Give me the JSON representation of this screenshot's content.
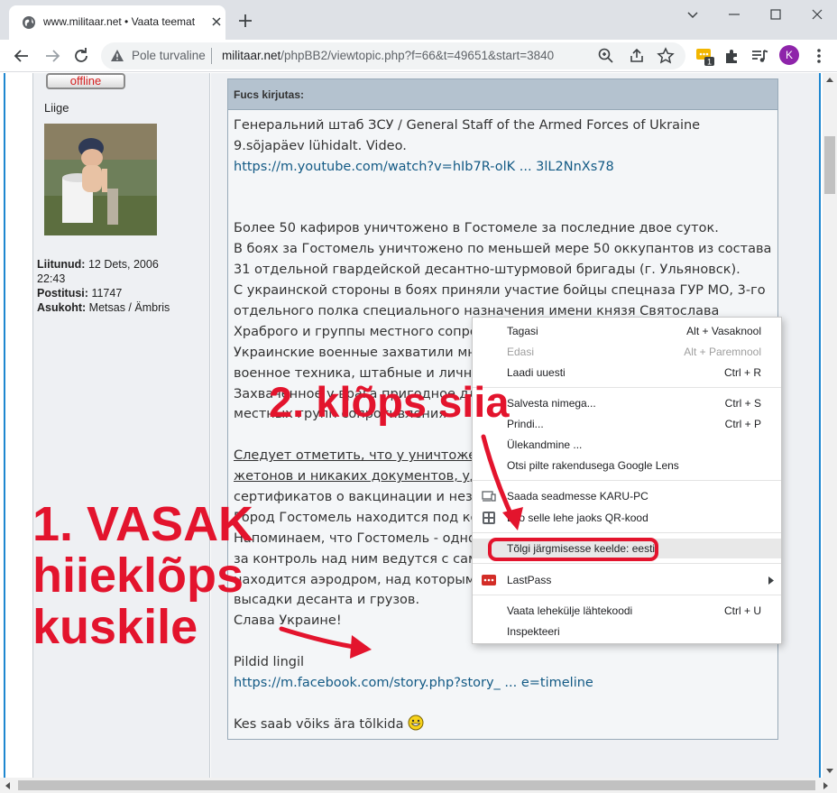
{
  "browser": {
    "tab_title": "www.militaar.net • Vaata teemat",
    "security_label": "Pole turvaline",
    "url_host": "militaar.net",
    "url_path": "/phpBB2/viewtopic.php?f=66&t=49651&start=3840",
    "extension_badge": "1",
    "profile_initial": "K"
  },
  "user": {
    "status_button": "offline",
    "rank": "Liige",
    "joined_label": "Liitunud:",
    "joined_value": "12 Dets, 2006",
    "joined_time": "22:43",
    "posts_label": "Postitusi:",
    "posts_value": "11747",
    "location_label": "Asukoht:",
    "location_value": "Metsas / Ämbris"
  },
  "quote": {
    "header": "Fucs kirjutas:",
    "line1": "Генеральний штаб ЗСУ / General Staff of the Armed Forces of Ukraine",
    "line2": "9.sõjapäev lühidalt. Video.",
    "link1": "https://m.youtube.com/watch?v=hIb7R-olK ... 3lL2NnXs78",
    "p1": "Более 50 кафиров уничтожено в Гостомеле за последние двое суток.",
    "p2": "В боях за Гостомель уничтожено по меньшей мере 50 оккупантов из состава",
    "p3": "31 отдельной гвардейской десантно-штурмовой бригады (г. Ульяновск).",
    "p4": "С украинской стороны в боях приняли участие бойцы спецназа ГУР МО, 3-го",
    "p5": "отдельного полка специального назначения имени князя Святослава",
    "p6": "Храброго и группы местного сопро",
    "p7": "Украинские военные захватили мн",
    "p8": "военное техника, штабные и личны",
    "p9": "Захваченное у врага пригодное дл",
    "p10": "местных групп сопротивления",
    "p11a": "Следует отметить, что у уничтожен",
    "p11b": "жетонов и никаких документов, уд",
    "p12": "сертификатов о вакцинации и неза",
    "p13": "Город Гостомель находится под ко",
    "p14": "Напоминаем, что Гостомель - одно",
    "p15": "за контроль над ним ведутся с сам",
    "p16": "находится аэродром, над которым",
    "p17": "высадки десанта и грузов.",
    "p18": "Слава Украине!",
    "pics_label": "Pildid lingil",
    "link2": "https://m.facebook.com/story.php?story_ ... e=timeline",
    "last_line": "Kes saab võiks ära tõlkida"
  },
  "context_menu": {
    "items": [
      {
        "label": "Tagasi",
        "shortcut": "Alt + Vasaknool"
      },
      {
        "label": "Edasi",
        "shortcut": "Alt + Paremnool"
      },
      {
        "label": "Laadi uuesti",
        "shortcut": "Ctrl + R"
      },
      {
        "label": "Salvesta nimega...",
        "shortcut": "Ctrl + S"
      },
      {
        "label": "Prindi...",
        "shortcut": "Ctrl + P"
      },
      {
        "label": "Ülekandmine ...",
        "shortcut": ""
      },
      {
        "label": "Otsi pilte rakendusega Google Lens",
        "shortcut": ""
      },
      {
        "label": "Saada seadmesse KARU-PC",
        "shortcut": ""
      },
      {
        "label": "Loo selle lehe jaoks QR-kood",
        "shortcut": ""
      },
      {
        "label": "Tõlgi järgmisesse keelde: eesti",
        "shortcut": ""
      },
      {
        "label": "LastPass",
        "shortcut": ""
      },
      {
        "label": "Vaata lehekülje lähtekoodi",
        "shortcut": "Ctrl + U"
      },
      {
        "label": "Inspekteeri",
        "shortcut": ""
      }
    ]
  },
  "annotations": {
    "step2": "2. klõps siia",
    "step1_line1": "1. VASAK",
    "step1_line2": "hiieklõps",
    "step1_line3": "kuskile"
  },
  "colors": {
    "annotation_red": "#e3142d",
    "link_blue": "#135a85",
    "frame_blue": "#1e87d0"
  }
}
